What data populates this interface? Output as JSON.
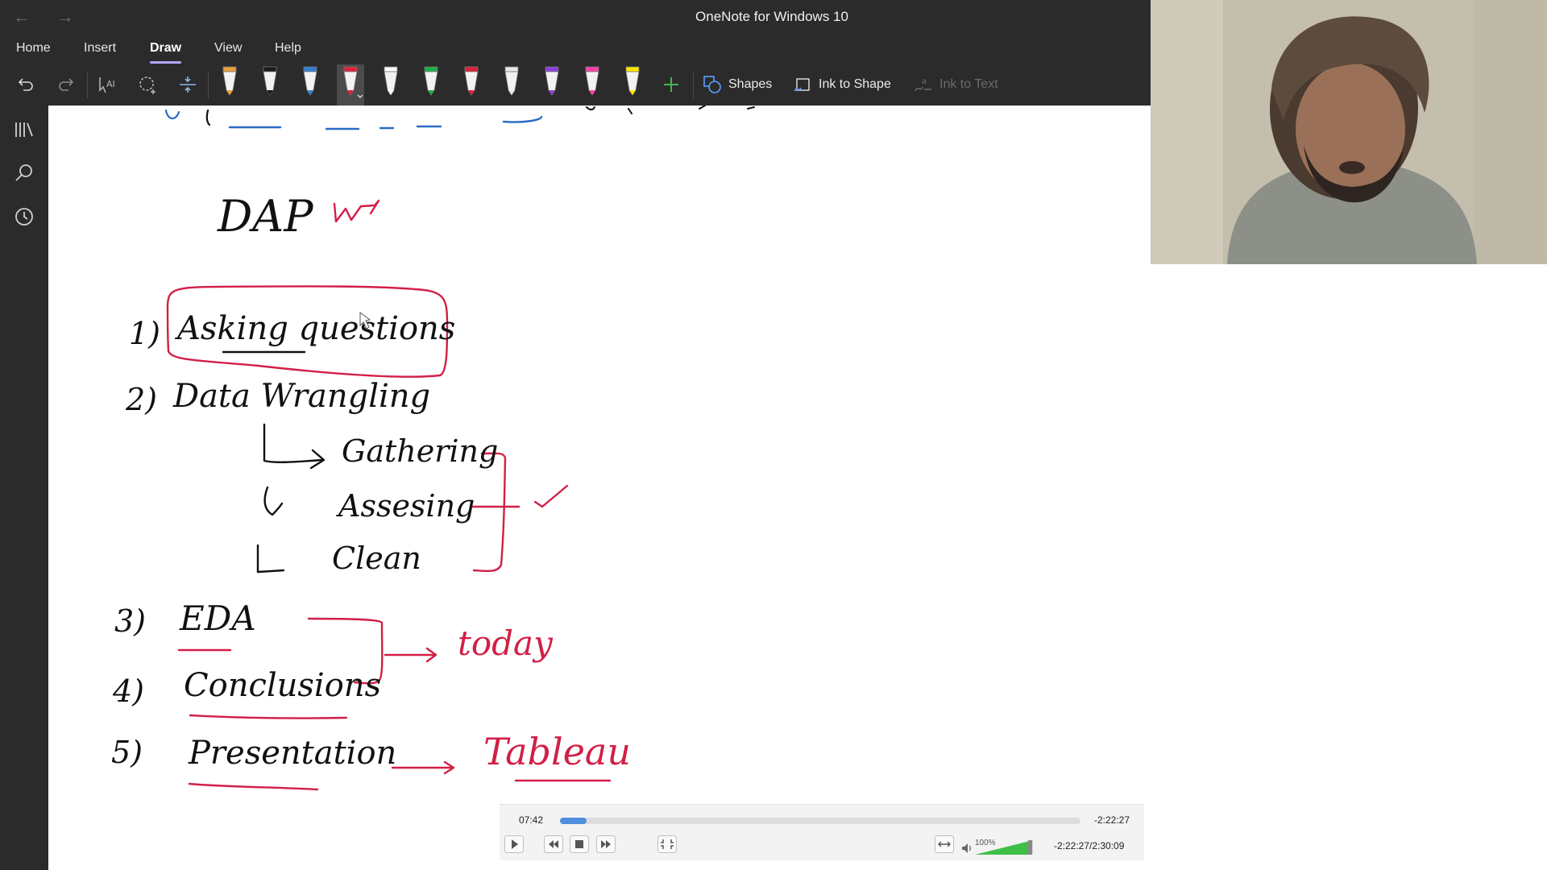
{
  "window": {
    "title": "OneNote for Windows 10",
    "nav_back_icon": "arrow-left-icon",
    "nav_forward_icon": "arrow-right-icon"
  },
  "menu": {
    "items": [
      {
        "label": "Home"
      },
      {
        "label": "Insert"
      },
      {
        "label": "Draw",
        "active": true
      },
      {
        "label": "View"
      },
      {
        "label": "Help"
      }
    ]
  },
  "ribbon": {
    "shapes_label": "Shapes",
    "ink_to_shape_label": "Ink to Shape",
    "ink_to_text_label": "Ink to Text",
    "pen_colors": [
      "#e9a03a",
      "#1a1a1a",
      "#2f7fd6",
      "#e0203a",
      "#ffffff",
      "#1fae4a",
      "#e0203a",
      "#e8e8e8",
      "#8b3fd9",
      "#ff3fa8",
      "#ffe500"
    ],
    "selected_pen": 3
  },
  "notes": {
    "heading": "DAP",
    "heading_mark": "W",
    "steps": [
      {
        "num": "1)",
        "text": "Asking questions"
      },
      {
        "num": "2)",
        "text": "Data Wrangling"
      },
      {
        "num": "3)",
        "text": "EDA"
      },
      {
        "num": "4)",
        "text": "Conclusions"
      },
      {
        "num": "5)",
        "text": "Presentation"
      }
    ],
    "wrangling_substeps": [
      "Gathering",
      "Assesing",
      "Clean"
    ],
    "annotation_today": "today",
    "annotation_tool": "Tableau",
    "ink_color_black": "#111111",
    "ink_color_red": "#d21f47",
    "ink_color_blue": "#2a6cc4"
  },
  "player": {
    "elapsed": "07:42",
    "remaining": "-2:22:27",
    "time_readout": "-2:22:27/2:30:09",
    "progress": 0.0513,
    "volume_label": "100%",
    "volume": 1.0,
    "accent": "#4f8fde"
  }
}
